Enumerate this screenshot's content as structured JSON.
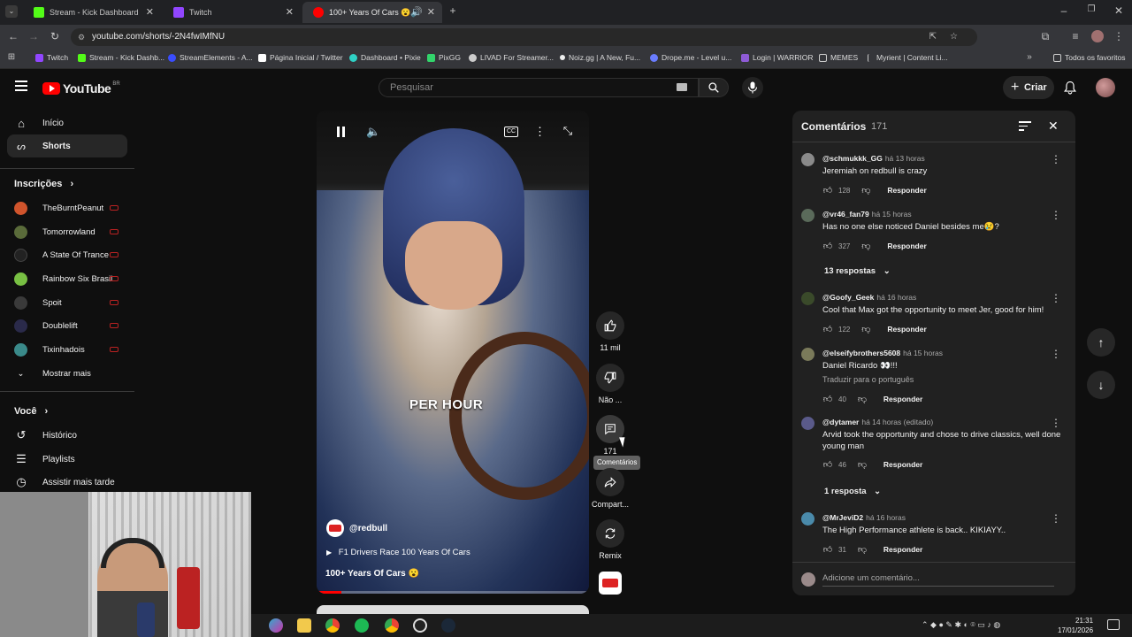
{
  "browser": {
    "tabs": [
      {
        "title": "Stream - Kick Dashboard",
        "color": "#53fc18"
      },
      {
        "title": "Twitch",
        "color": "#9146ff"
      },
      {
        "title": "100+ Years Of Cars 😮 - Yo",
        "color": "#ff0000"
      }
    ],
    "url": "youtube.com/shorts/-2N4fwIMfNU",
    "bookmarks": [
      {
        "label": "Twitch",
        "color": "#9146ff"
      },
      {
        "label": "Stream - Kick Dashb...",
        "color": "#53fc18"
      },
      {
        "label": "StreamElements - A...",
        "color": "#3a4dff"
      },
      {
        "label": "Página Inicial / Twitter",
        "color": "#ffffff"
      },
      {
        "label": "Dashboard • Pixie",
        "color": "#2fd1c5"
      },
      {
        "label": "PixGG",
        "color": "#32d46b"
      },
      {
        "label": "LIVAD For Streamer...",
        "color": "#cccccc"
      },
      {
        "label": "Noiz.gg | A New, Fu...",
        "color": "#eeeeee"
      },
      {
        "label": "Drope.me - Level u...",
        "color": "#6a7dff"
      },
      {
        "label": "Login | WARRIOR",
        "color": "#8e5bd6"
      },
      {
        "label": "MEMES",
        "color": "#cccccc"
      },
      {
        "label": "Myrient | Content Li...",
        "color": "#cccccc"
      }
    ],
    "bookmarks_right": "Todos os favoritos"
  },
  "header": {
    "logo_text": "YouTube",
    "logo_region": "BR",
    "search_placeholder": "Pesquisar",
    "create_label": "Criar"
  },
  "sidebar": {
    "main": [
      {
        "label": "Início",
        "icon": "home-icon"
      },
      {
        "label": "Shorts",
        "icon": "shorts-icon"
      }
    ],
    "subs_title": "Inscrições",
    "subscriptions": [
      {
        "name": "TheBurntPeanut",
        "color": "#d0542c"
      },
      {
        "name": "Tomorrowland",
        "color": "#5a6b3a"
      },
      {
        "name": "A State Of Trance",
        "color": "#222222"
      },
      {
        "name": "Rainbow Six Brasil",
        "color": "#78c043"
      },
      {
        "name": "Spoit",
        "color": "#3a3a3a"
      },
      {
        "name": "Doublelift",
        "color": "#2a2a4a"
      },
      {
        "name": "Tixinhadois",
        "color": "#3a8a8a"
      }
    ],
    "show_more": "Mostrar mais",
    "you_title": "Você",
    "you_items": [
      {
        "label": "Histórico",
        "icon": "history-icon"
      },
      {
        "label": "Playlists",
        "icon": "playlists-icon"
      },
      {
        "label": "Assistir mais tarde",
        "icon": "watch-later-icon"
      }
    ]
  },
  "video": {
    "overlay_caption": "PER HOUR",
    "channel": "@redbull",
    "song": "F1 Drivers Race 100 Years Of Cars",
    "title": "100+ Years Of Cars 😮",
    "progress": 0.09
  },
  "actions": {
    "likes": "11 mil",
    "dislike": "Não ...",
    "comments": "171",
    "comments_tooltip": "Comentários",
    "share": "Compart...",
    "remix": "Remix"
  },
  "comments_panel": {
    "title": "Comentários",
    "count": "171",
    "reply_label": "Responder",
    "add_placeholder": "Adicione um comentário...",
    "items": [
      {
        "author": "@schmukkk_GG",
        "time": "há 13 horas",
        "text": "Jeremiah on redbull is crazy",
        "likes": "128",
        "color": "#8a8a8a"
      },
      {
        "author": "@vr46_fan79",
        "time": "há 15 horas",
        "text": "Has no one else noticed Daniel besides me😢?",
        "likes": "327",
        "color": "#5a6a5a"
      },
      {
        "author": "@Goofy_Geek",
        "time": "há 16 horas",
        "text": "Cool that Max got the opportunity to meet Jer, good for him!",
        "likes": "122",
        "color": "#3a4a2a"
      },
      {
        "author": "@elseifybrothers5608",
        "time": "há 15 horas",
        "text": "Daniel Ricardo 👀!!!",
        "likes": "40",
        "color": "#7a7a5a",
        "translate": "Traduzir para o português"
      },
      {
        "author": "@dytamer",
        "time": "há 14 horas (editado)",
        "text": "Arvid took the opportunity and chose to drive classics, well done young man",
        "likes": "46",
        "color": "#5a5a8a"
      },
      {
        "author": "@MrJeviD2",
        "time": "há 16 horas",
        "text": "The High Performance athlete is back.. KIKIAYY..",
        "likes": "31",
        "color": "#4a8aaa"
      }
    ],
    "replies": [
      "13 respostas",
      "1 resposta"
    ]
  },
  "taskbar": {
    "time": "21:31",
    "date": "17/01/2026"
  }
}
